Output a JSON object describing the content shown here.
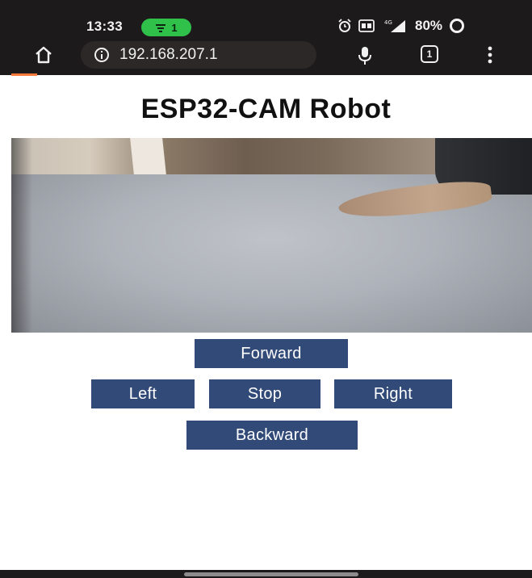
{
  "status_bar": {
    "time": "13:33",
    "hotspot_count": "1",
    "battery": "80%",
    "network": "4G"
  },
  "browser": {
    "url": "192.168.207.1",
    "tab_count": "1"
  },
  "page": {
    "title": "ESP32-CAM Robot"
  },
  "controls": {
    "forward": "Forward",
    "left": "Left",
    "stop": "Stop",
    "right": "Right",
    "backward": "Backward"
  },
  "colors": {
    "button_bg": "#324a78",
    "chrome_bg": "#1c1a1a",
    "hotspot_green": "#2fc14a",
    "progress_orange": "#ff7a3d"
  },
  "icons": [
    "home-icon",
    "info-icon",
    "mic-icon",
    "tabs-icon",
    "menu-icon",
    "alarm-icon",
    "hotspot-icon",
    "signal-icon",
    "battery-icon"
  ]
}
